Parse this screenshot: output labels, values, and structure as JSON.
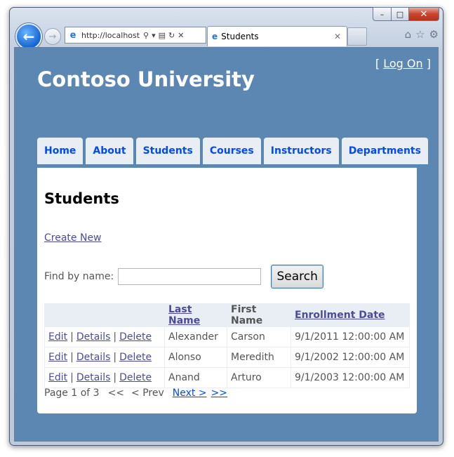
{
  "browser": {
    "address_url": "http://localhost:",
    "tab_title": "Students",
    "caption": {
      "min": "–",
      "max": "□",
      "close": "✕"
    }
  },
  "header": {
    "login_open": "[",
    "login_link": "Log On",
    "login_close": "]",
    "site_title": "Contoso University"
  },
  "menu": {
    "items": [
      {
        "label": "Home"
      },
      {
        "label": "About"
      },
      {
        "label": "Students"
      },
      {
        "label": "Courses"
      },
      {
        "label": "Instructors"
      },
      {
        "label": "Departments"
      }
    ]
  },
  "page": {
    "title": "Students",
    "create_new": "Create New",
    "find_label": "Find by name:",
    "search_value": "",
    "search_button": "Search"
  },
  "table": {
    "headers": {
      "actions": "",
      "last_name": "Last Name",
      "first_name": "First Name",
      "enrollment": "Enrollment Date"
    },
    "actions": {
      "edit": "Edit",
      "details": "Details",
      "delete": "Delete",
      "sep": "|"
    },
    "rows": [
      {
        "last": "Alexander",
        "first": "Carson",
        "date": "9/1/2011 12:00:00 AM"
      },
      {
        "last": "Alonso",
        "first": "Meredith",
        "date": "9/1/2002 12:00:00 AM"
      },
      {
        "last": "Anand",
        "first": "Arturo",
        "date": "9/1/2003 12:00:00 AM"
      }
    ]
  },
  "pager": {
    "status": "Page 1 of 3",
    "first": "<<",
    "prev": "< Prev",
    "next": "Next >",
    "last": ">>"
  }
}
